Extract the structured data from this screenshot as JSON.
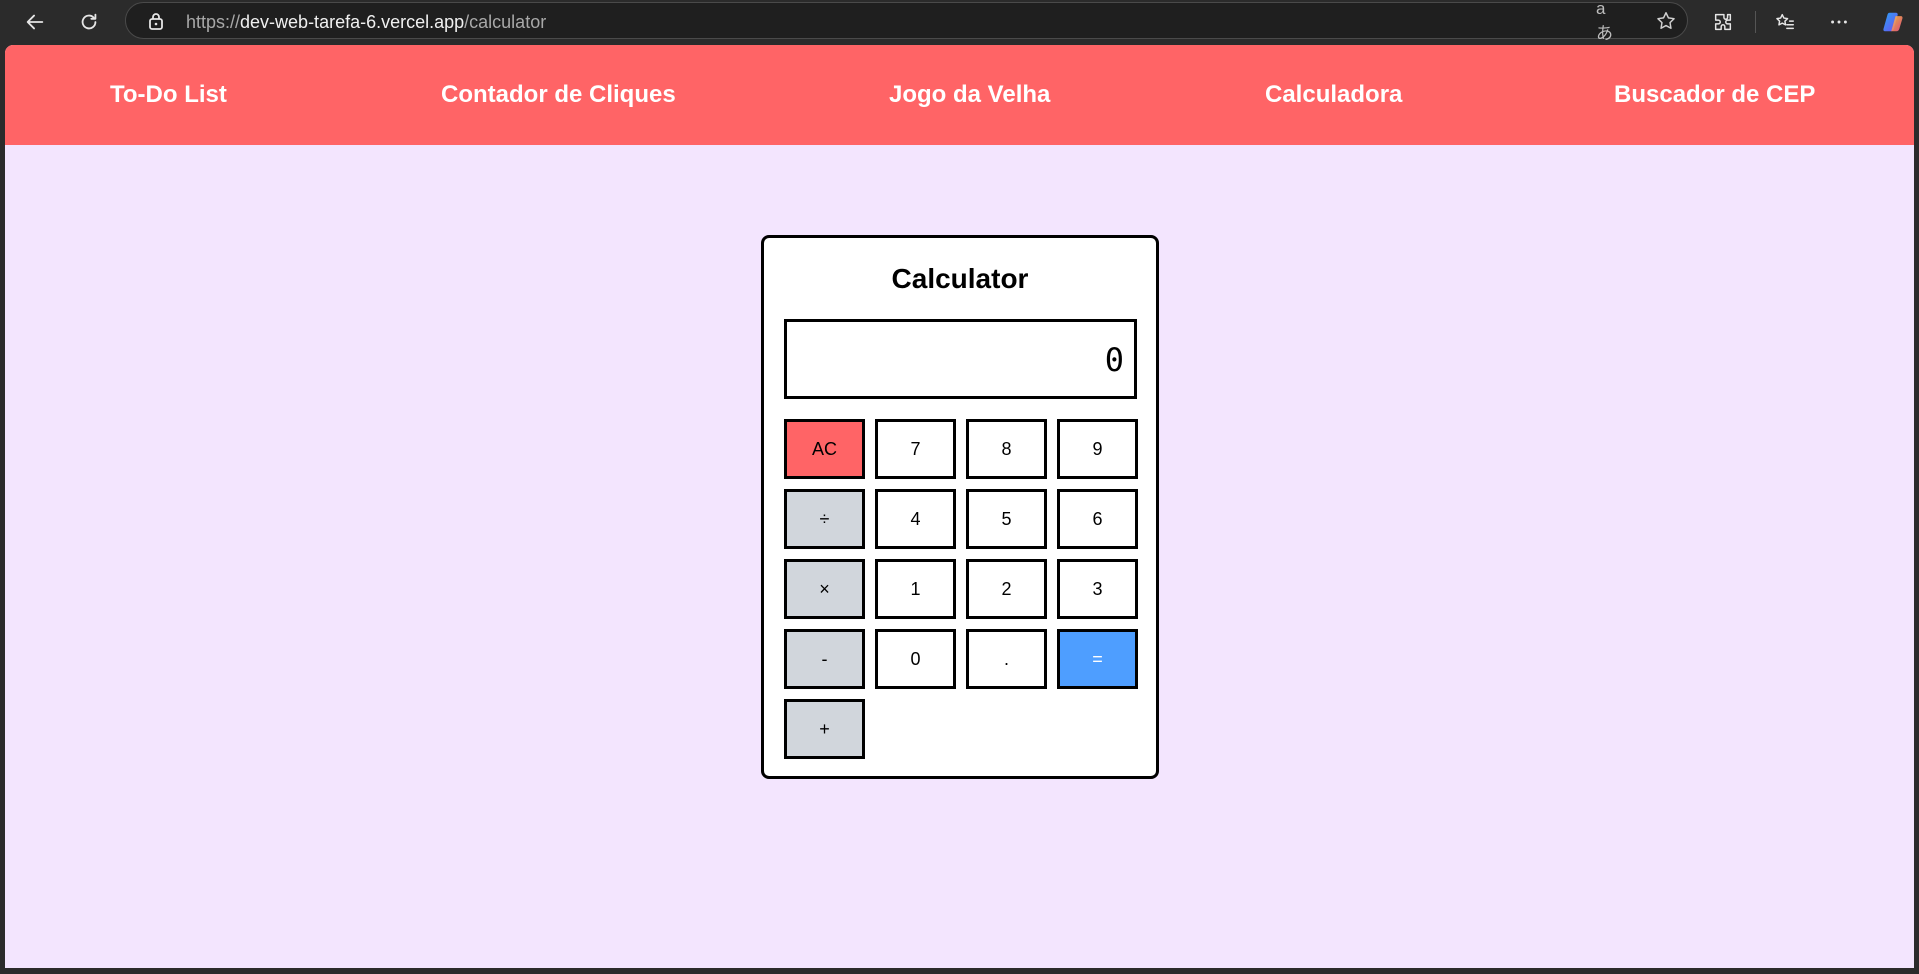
{
  "browser": {
    "url_scheme": "https://",
    "url_host": "dev-web-tarefa-6.vercel.app",
    "url_path": "/calculator",
    "icons": [
      "back-icon",
      "refresh-icon",
      "lock-icon",
      "translate-icon",
      "favorite-star-icon",
      "extensions-icon",
      "favorites-list-icon",
      "more-icon",
      "copilot-icon"
    ],
    "translate_glyph": "aあ"
  },
  "nav": {
    "items": [
      {
        "label": "To-Do List"
      },
      {
        "label": "Contador de Cliques"
      },
      {
        "label": "Jogo da Velha"
      },
      {
        "label": "Calculadora"
      },
      {
        "label": "Buscador de CEP"
      }
    ],
    "background": "#ff6466"
  },
  "calculator": {
    "title": "Calculator",
    "display_value": "0",
    "keys": {
      "clear": "AC",
      "seven": "7",
      "eight": "8",
      "nine": "9",
      "divide": "÷",
      "four": "4",
      "five": "5",
      "six": "6",
      "multiply": "×",
      "one": "1",
      "two": "2",
      "three": "3",
      "subtract": "-",
      "zero": "0",
      "decimal": ".",
      "equals": "=",
      "add": "+"
    },
    "colors": {
      "clear": "#ff6466",
      "operator": "#d1d6dc",
      "equals": "#4e9eff",
      "page_background": "#f3e5fe"
    }
  }
}
